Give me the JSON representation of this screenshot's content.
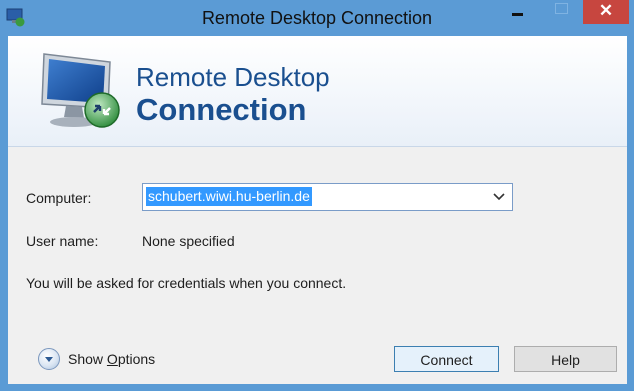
{
  "window": {
    "title": "Remote Desktop Connection",
    "close_glyph": "✕"
  },
  "banner": {
    "line1": "Remote Desktop",
    "line2": "Connection"
  },
  "form": {
    "computer_label": "Computer:",
    "computer_value": "schubert.wiwi.hu-berlin.de",
    "username_label": "User name:",
    "username_value": "None specified",
    "info_text": "You will be asked for credentials when you connect."
  },
  "footer": {
    "show_options_prefix": "Show ",
    "show_options_underlined": "O",
    "show_options_suffix": "ptions",
    "connect_label": "Connect",
    "help_label": "Help"
  },
  "colors": {
    "titlebar": "#5b9bd5",
    "close_button": "#c7463f",
    "banner_text": "#1a4f8f",
    "selection": "#3399ff"
  },
  "icons": [
    "app-icon",
    "minimize-icon",
    "maximize-icon",
    "close-icon",
    "monitor-icon",
    "dropdown-arrow-icon",
    "expand-options-icon"
  ]
}
